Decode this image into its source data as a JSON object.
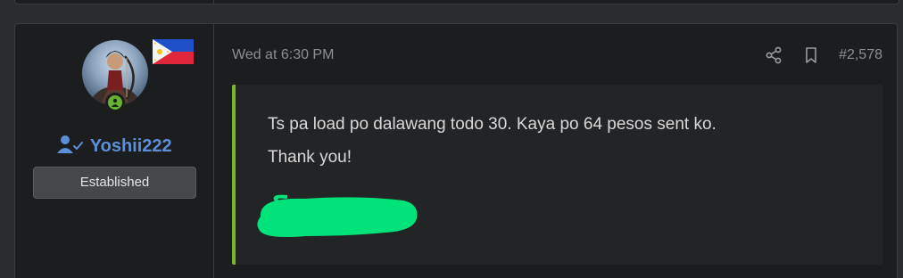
{
  "post": {
    "date": "Wed at 6:30 PM",
    "post_number": "#2,578",
    "message_lines": [
      "Ts pa load po dalawang todo 30. Kaya po 64 pesos sent ko.",
      "Thank you!"
    ],
    "quote_accent_color": "#76b82a",
    "redaction_color": "#00e27a"
  },
  "user": {
    "username": "Yoshii222",
    "title": "Established",
    "username_color": "#5b8fd8",
    "online_status_color": "#67b231",
    "flag": "philippines-flag-icon"
  },
  "icons": {
    "share": "share-icon",
    "bookmark": "bookmark-icon",
    "user": "user-check-icon",
    "online": "user-online-icon"
  }
}
